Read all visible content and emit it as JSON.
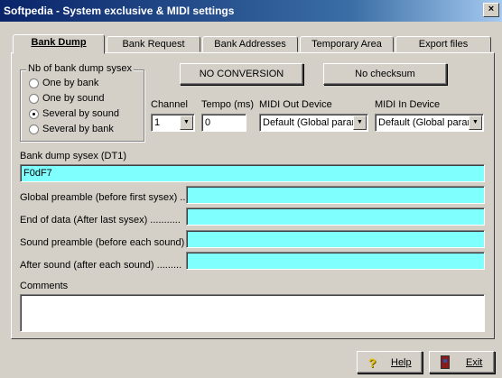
{
  "window": {
    "title": "Softpedia - System exclusive & MIDI settings",
    "close": "×"
  },
  "tabs": [
    "Bank Dump",
    "Bank Request",
    "Bank Addresses",
    "Temporary Area",
    "Export files"
  ],
  "bank_dump_sysex_group": {
    "label": "Nb of bank dump sysex",
    "options": [
      "One by bank",
      "One by sound",
      "Several by sound",
      "Several by bank"
    ],
    "selected": "Several by sound"
  },
  "buttons": {
    "conversion": "NO CONVERSION",
    "checksum": "No checksum",
    "help": "Help",
    "exit": "Exit"
  },
  "channel": {
    "label": "Channel",
    "value": "1"
  },
  "tempo": {
    "label": "Tempo (ms)",
    "value": "0"
  },
  "midi_out": {
    "label": "MIDI Out Device",
    "value": "Default (Global param"
  },
  "midi_in": {
    "label": "MIDI In Device",
    "value": "Default (Global param"
  },
  "bank_dump_sysex": {
    "label": "Bank dump sysex (DT1)",
    "value": "F0dF7"
  },
  "global_preamble": {
    "label": "Global preamble (before first sysex) ..",
    "value": ""
  },
  "end_of_data": {
    "label": "End of data (After last sysex) ...........",
    "value": ""
  },
  "sound_preamble": {
    "label": "Sound preamble (before each sound)",
    "value": ""
  },
  "after_sound": {
    "label": "After sound (after each sound) .........",
    "value": ""
  },
  "comments": {
    "label": "Comments",
    "value": ""
  },
  "colors": {
    "field_cyan": "#80ffff",
    "titlebar": "#0a246a"
  }
}
